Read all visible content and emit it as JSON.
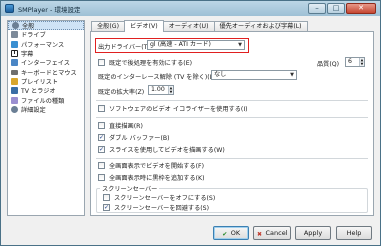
{
  "window": {
    "title": "SMPlayer - 環境設定"
  },
  "sidebar": {
    "items": [
      {
        "label": "全般",
        "icon": "gear-icon",
        "color": "#6b7f95",
        "selected": true
      },
      {
        "label": "ドライブ",
        "icon": "drive-icon",
        "color": "#7d8a99"
      },
      {
        "label": "パフォーマンス",
        "icon": "performance-icon",
        "color": "#3a8fd1"
      },
      {
        "label": "字幕",
        "icon": "subtitles-icon",
        "color": "#222222"
      },
      {
        "label": "インターフェイス",
        "icon": "interface-icon",
        "color": "#4a86c5"
      },
      {
        "label": "キーボードとマウス",
        "icon": "keyboard-icon",
        "color": "#6e6e6e"
      },
      {
        "label": "プレイリスト",
        "icon": "playlist-icon",
        "color": "#d9a62c"
      },
      {
        "label": "TV とラジオ",
        "icon": "tv-icon",
        "color": "#3a6ea5"
      },
      {
        "label": "ファイルの種類",
        "icon": "file-types-icon",
        "color": "#9a8fd1"
      },
      {
        "label": "詳細設定",
        "icon": "advanced-icon",
        "color": "#6b7f95"
      }
    ]
  },
  "tabs": [
    {
      "label": "全般(G)",
      "active": false
    },
    {
      "label": "ビデオ(V)",
      "active": true
    },
    {
      "label": "オーディオ(U)",
      "active": false
    },
    {
      "label": "優先オーディオおよび字幕(L)",
      "active": false
    }
  ],
  "video": {
    "output_driver_label": "出力ドライバー(T)",
    "output_driver_value": "gl (高速 - ATI カード)",
    "postprocess_label": "既定で後処理を有効にする(E)",
    "postprocess_checked": false,
    "quality_label": "品質(Q)",
    "quality_value": "6",
    "deinterlace_label": "既定のインターレース解除 (TV を除く)(D)",
    "deinterlace_value": "なし",
    "zoom_label": "既定の拡大率(Z)",
    "zoom_value": "1.00",
    "software_eq_label": "ソフトウェアのビデオ イコライザーを使用する(I)",
    "software_eq_checked": false,
    "direct_render_label": "直接描画(R)",
    "direct_render_checked": false,
    "double_buffer_label": "ダブル バッファー(B)",
    "double_buffer_checked": true,
    "slices_label": "スライスを使用してビデオを描画する(W)",
    "slices_checked": true,
    "fullscreen_start_label": "全画面表示でビデオを開始する(F)",
    "fullscreen_start_checked": false,
    "fullscreen_black_label": "全画面表示時に黒枠を追加する(K)",
    "fullscreen_black_checked": false,
    "screensaver_group": "スクリーンセーバー",
    "screensaver_off_label": "スクリーンセーバーをオフにする(S)",
    "screensaver_off_checked": false,
    "screensaver_avoid_label": "スクリーンセーバーを回避する(S)",
    "screensaver_avoid_checked": true
  },
  "buttons": {
    "ok": "OK",
    "cancel": "Cancel",
    "apply": "Apply",
    "help": "Help"
  },
  "colors": {
    "highlight_border": "#e02020",
    "selection": "#cfe3f6"
  }
}
